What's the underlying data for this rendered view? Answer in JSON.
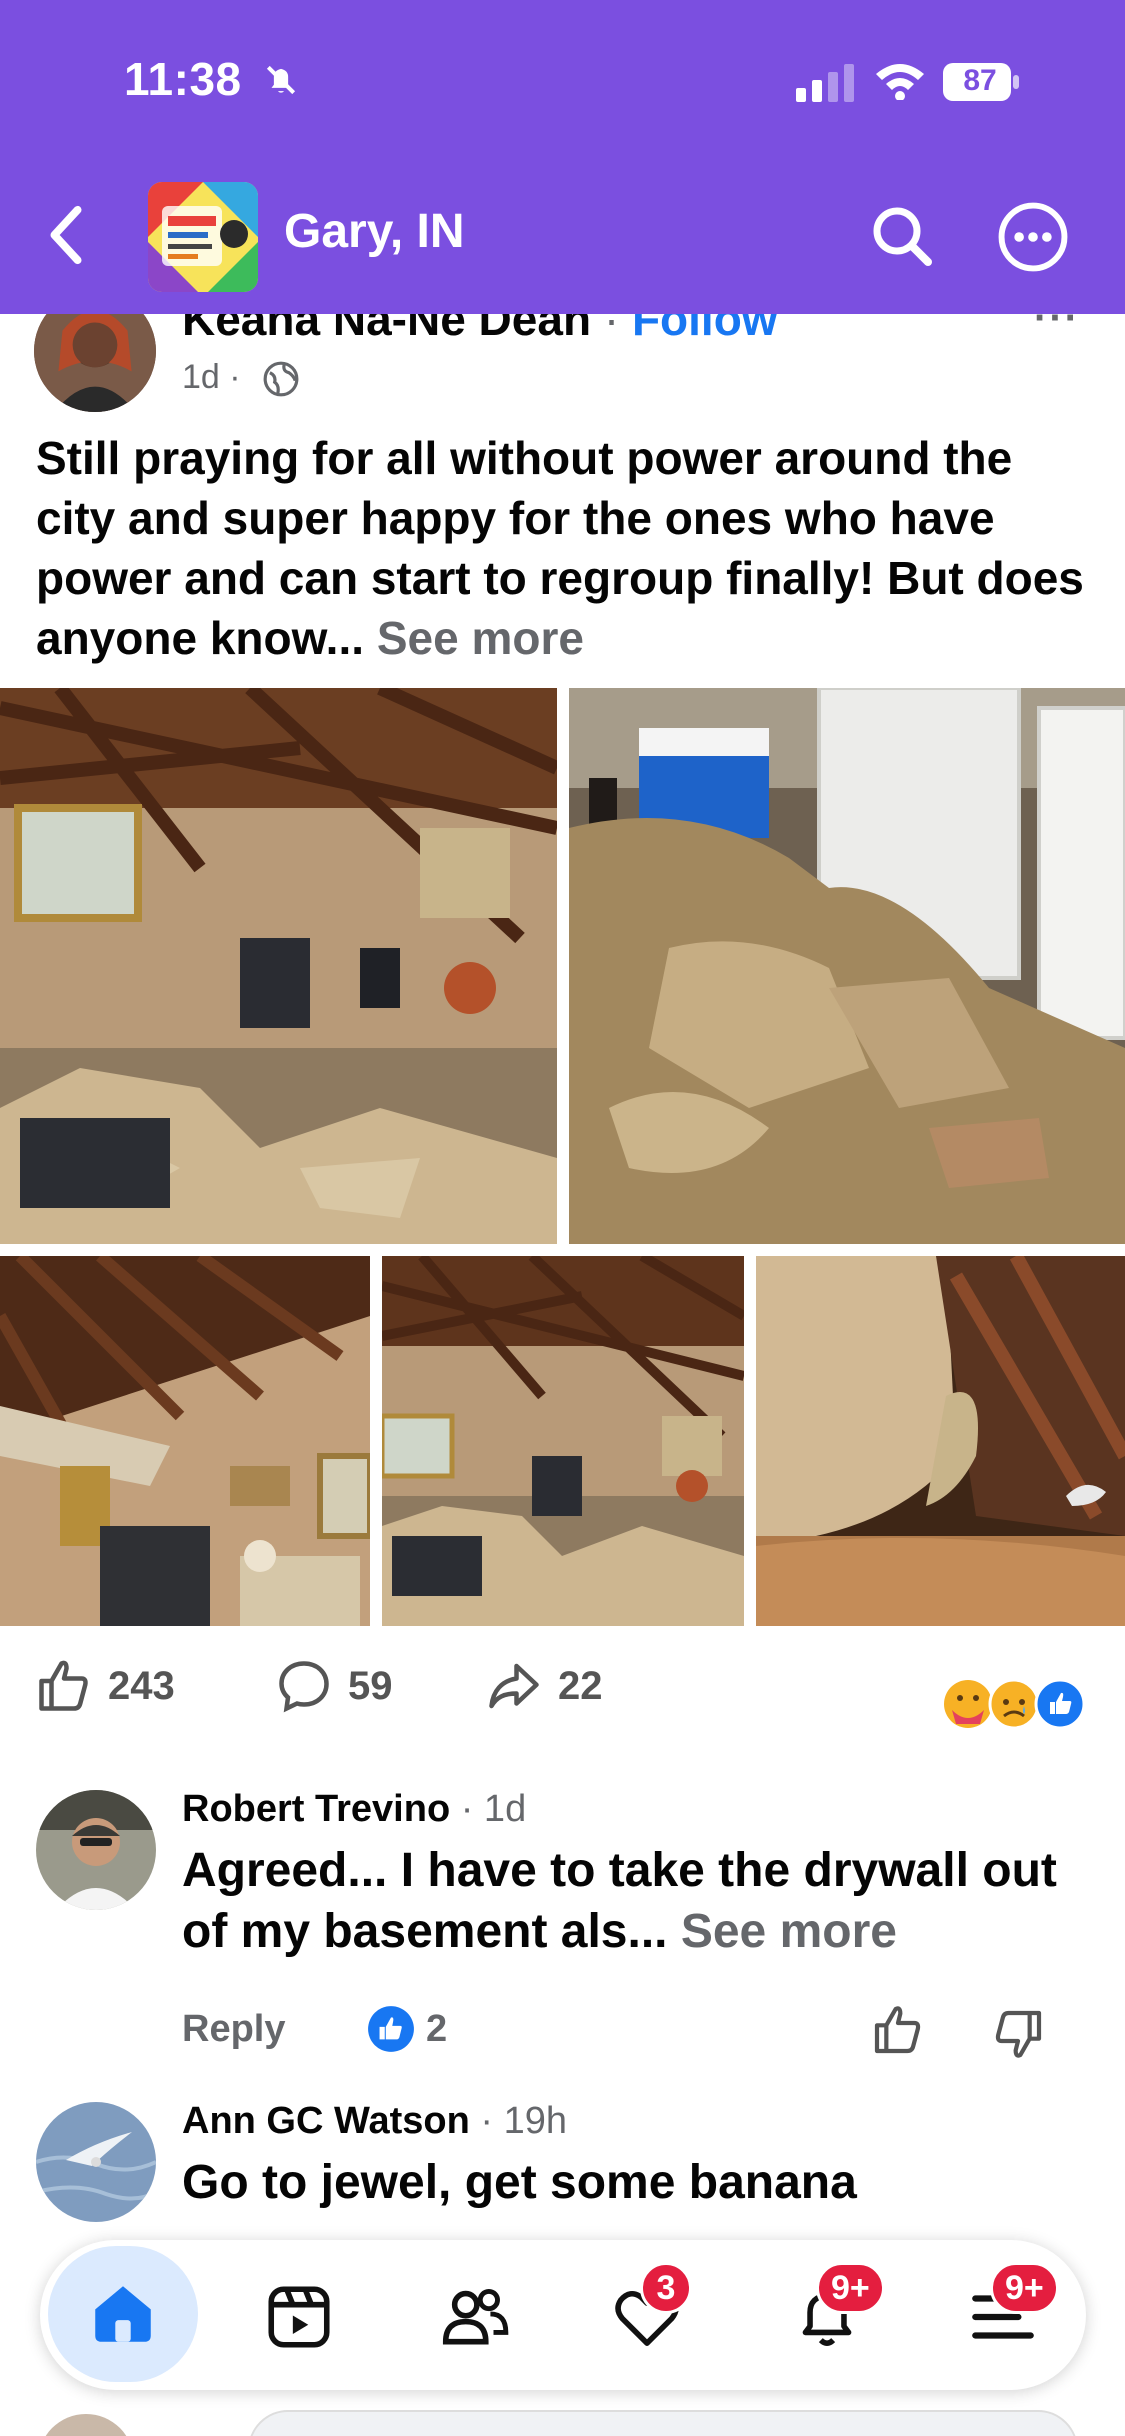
{
  "status": {
    "time": "11:38",
    "battery": "87"
  },
  "header": {
    "group_name": "Gary, IN"
  },
  "post": {
    "author": "Keana Na-Ne Dean",
    "separator": "·",
    "follow_label": "Follow",
    "menu_label": "···",
    "time": "1d ·",
    "text": "Still praying for all without power around the city and super happy for the ones who have power and can start to regroup finally! But does anyone know... ",
    "see_more": "See more",
    "likes": "243",
    "comments": "59",
    "shares": "22"
  },
  "comments": [
    {
      "name": "Robert Trevino",
      "time": "· 1d",
      "text": "Agreed... I have to take the drywall out of my basement als... ",
      "see_more": "See more",
      "reply_label": "Reply",
      "like_count": "2"
    },
    {
      "name": "Ann GC Watson",
      "time": "· 19h",
      "text": "Go to jewel, get some banana"
    }
  ],
  "nav": {
    "items": [
      "home",
      "video",
      "friends",
      "dating",
      "notifications",
      "menu"
    ],
    "badges": {
      "dating": "3",
      "notifications": "9+",
      "menu": "9+"
    }
  },
  "colors": {
    "header": "#7b4fe0",
    "link": "#1877f2",
    "badge": "#e41e3f"
  }
}
